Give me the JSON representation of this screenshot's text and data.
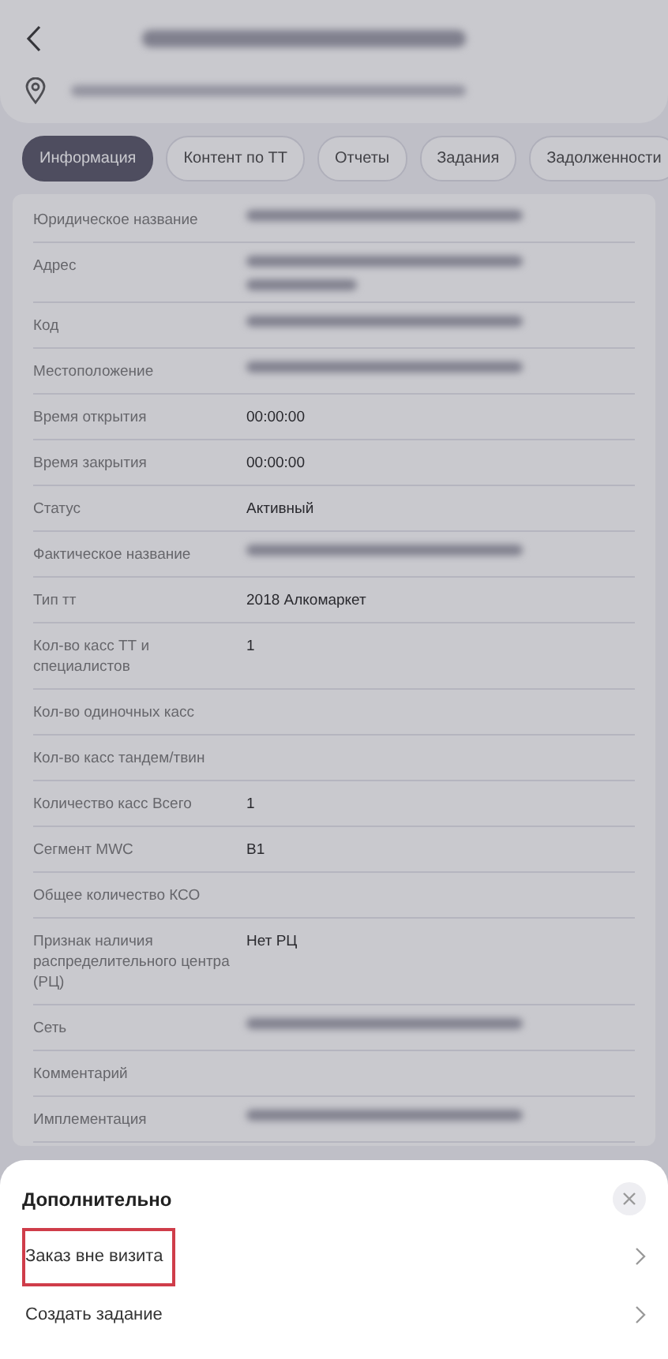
{
  "header": {
    "title_redacted": true,
    "address_redacted": true
  },
  "tabs": [
    {
      "label": "Информация",
      "selected": true
    },
    {
      "label": "Контент по ТТ",
      "selected": false
    },
    {
      "label": "Отчеты",
      "selected": false
    },
    {
      "label": "Задания",
      "selected": false
    },
    {
      "label": "Задолженности",
      "selected": false
    }
  ],
  "fields": [
    {
      "label": "Юридическое название",
      "redacted": true
    },
    {
      "label": "Адрес",
      "redacted": true,
      "wrapped": true
    },
    {
      "label": "Код",
      "redacted": true
    },
    {
      "label": "Местоположение",
      "redacted": true
    },
    {
      "label": "Время открытия",
      "value": "00:00:00"
    },
    {
      "label": "Время закрытия",
      "value": "00:00:00"
    },
    {
      "label": "Статус",
      "value": "Активный"
    },
    {
      "label": "Фактическое название",
      "redacted": true
    },
    {
      "label": "Тип тт",
      "value": "2018 Алкомаркет"
    },
    {
      "label": "Кол-во касс ТТ и специалистов",
      "value": "1"
    },
    {
      "label": "Кол-во одиночных касс"
    },
    {
      "label": "Кол-во касс тандем/твин"
    },
    {
      "label": "Количество касс Всего",
      "value": "1"
    },
    {
      "label": "Сегмент MWC",
      "value": "B1"
    },
    {
      "label": "Общее количество КСО"
    },
    {
      "label": "Признак наличия распределительного центра (РЦ)",
      "value": "Нет РЦ"
    },
    {
      "label": "Сеть",
      "redacted": true
    },
    {
      "label": "Комментарий"
    },
    {
      "label": "Имплементация",
      "redacted": true
    }
  ],
  "sheet": {
    "title": "Дополнительно",
    "items": [
      {
        "label": "Заказ вне визита",
        "highlighted": true
      },
      {
        "label": "Создать задание",
        "highlighted": false
      }
    ]
  }
}
